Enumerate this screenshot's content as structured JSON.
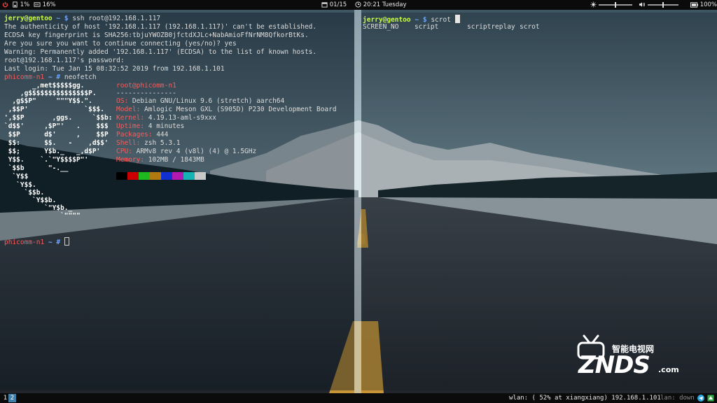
{
  "topbar": {
    "battery_pct": "1%",
    "memory_pct": "16%",
    "date": "01/15",
    "time": "20:21",
    "weekday": "Tuesday",
    "brightness_level": 0.5,
    "volume_level": 0.5,
    "power_pct": "100%"
  },
  "left_terminal": {
    "prompt1": {
      "user": "jerry@gentoo",
      "path": "~",
      "symbol": "$",
      "cmd": "ssh root@192.168.1.117"
    },
    "output": [
      "The authenticity of host '192.168.1.117 (192.168.1.117)' can't be established.",
      "ECDSA key fingerprint is SHA256:tbjuYWOZB0jfctdXJLc+NabAmioFfNrNM8QfkorBtKs.",
      "Are you sure you want to continue connecting (yes/no)? yes",
      "Warning: Permanently added '192.168.1.117' (ECDSA) to the list of known hosts.",
      "root@192.168.1.117's password:",
      "Last login: Tue Jan 15 08:32:52 2019 from 192.168.1.101"
    ],
    "prompt2": {
      "host": "phicomm-n1",
      "path": "~",
      "symbol": "#",
      "cmd": "neofetch"
    },
    "ascii": [
      "       _,met$$$$$gg.",
      "    ,g$$$$$$$$$$$$$$$P.",
      "  ,g$$P\"     \"\"\"Y$$.\".",
      " ,$$P'              `$$$.",
      "',$$P       ,ggs.     `$$b:",
      "`d$$'     ,$P\"'   .    $$$",
      " $$P      d$'     ,    $$P",
      " $$:      $$.   -    ,d$$'",
      " $$;      Y$b._   _,d$P'",
      " Y$$.    `.`\"Y$$$$P\"'",
      " `$$b      \"-.__",
      "  `Y$$",
      "   `Y$$.",
      "     `$$b.",
      "       `Y$$b.",
      "          `\"Y$b._",
      "              `\"\"\"\""
    ],
    "neofetch": {
      "title": "root@phicomm-n1",
      "separator": "---------------",
      "info": [
        {
          "key": "OS:",
          "value": " Debian GNU/Linux 9.6 (stretch) aarch64"
        },
        {
          "key": "Model:",
          "value": " Amlogic Meson GXL (S905D) P230 Development Board"
        },
        {
          "key": "Kernel:",
          "value": " 4.19.13-aml-s9xxx"
        },
        {
          "key": "Uptime:",
          "value": " 4 minutes"
        },
        {
          "key": "Packages:",
          "value": " 444"
        },
        {
          "key": "Shell:",
          "value": " zsh 5.3.1"
        },
        {
          "key": "CPU:",
          "value": " ARMv8 rev 4 (v8l) (4) @ 1.5GHz"
        },
        {
          "key": "Memory:",
          "value": " 102MB / 1843MB"
        }
      ],
      "palette": [
        "#000000",
        "#cc0000",
        "#1fb81f",
        "#b07a10",
        "#1030d0",
        "#b01ab0",
        "#14b4b4",
        "#c8c8c8"
      ]
    },
    "prompt3": {
      "host": "phicomm-n1",
      "path": "~",
      "symbol": "#"
    }
  },
  "right_terminal": {
    "prompt": {
      "user": "jerry@gentoo",
      "path": "~",
      "symbol": "$",
      "cmd": "scrot"
    },
    "completions": [
      "SCREEN_NO",
      "script",
      "scriptreplay",
      "scrot"
    ]
  },
  "bottombar": {
    "workspaces": [
      "1",
      "2"
    ],
    "active_workspace": "2",
    "wlan_text": "wlan: ( 52% at xiangxiang) 192.168.1.101",
    "lan_text": "lan: down"
  },
  "watermark": {
    "small": "智能电视网",
    "big": "ZNDS",
    "suffix": ".com"
  },
  "colors": {
    "user_prompt": "#c9ff3a",
    "path": "#6aa6ff",
    "remote_host": "#ff5a5a",
    "active_workspace": "#3e7ea8",
    "bar_bg": "#0b0b0b"
  }
}
